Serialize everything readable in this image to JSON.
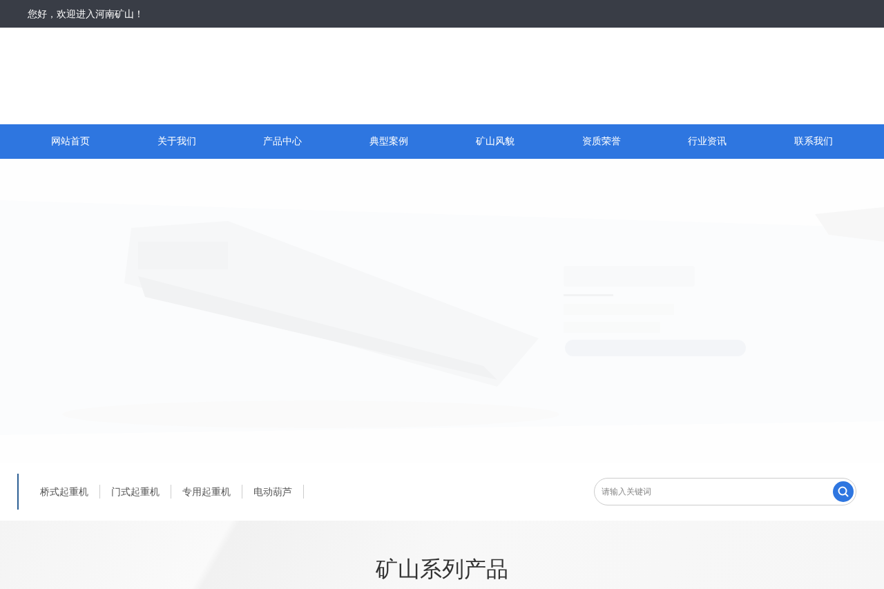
{
  "top_bar": {
    "greeting": "您好，欢迎进入河南矿山！"
  },
  "nav": {
    "items": [
      {
        "label": "网站首页"
      },
      {
        "label": "关于我们"
      },
      {
        "label": "产品中心"
      },
      {
        "label": "典型案例"
      },
      {
        "label": "矿山风貌"
      },
      {
        "label": "资质荣誉"
      },
      {
        "label": "行业资讯"
      },
      {
        "label": "联系我们"
      }
    ]
  },
  "categories": [
    "桥式起重机",
    "门式起重机",
    "专用起重机",
    "电动葫芦"
  ],
  "search": {
    "placeholder": "请输入关键词"
  },
  "section": {
    "title": "矿山系列产品"
  }
}
